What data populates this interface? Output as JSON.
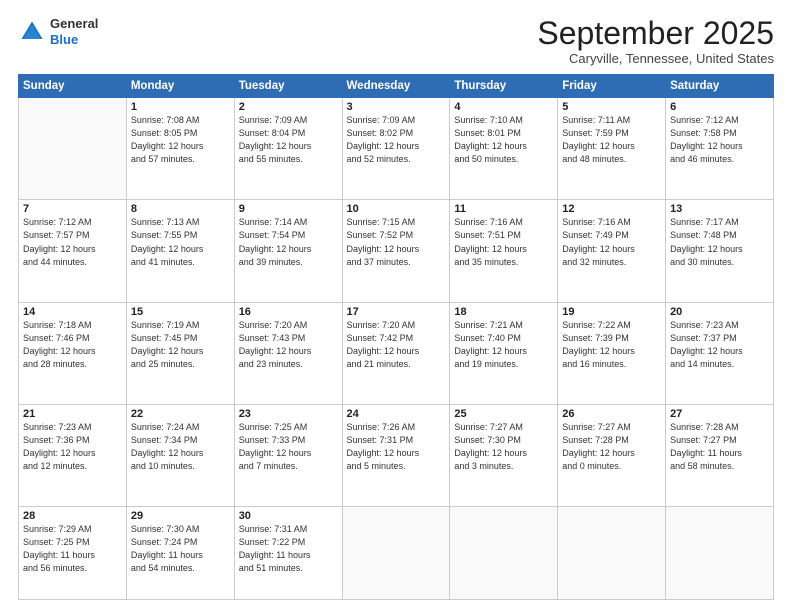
{
  "logo": {
    "general": "General",
    "blue": "Blue"
  },
  "header": {
    "month": "September 2025",
    "location": "Caryville, Tennessee, United States"
  },
  "days_of_week": [
    "Sunday",
    "Monday",
    "Tuesday",
    "Wednesday",
    "Thursday",
    "Friday",
    "Saturday"
  ],
  "weeks": [
    [
      {
        "day": "",
        "info": ""
      },
      {
        "day": "1",
        "info": "Sunrise: 7:08 AM\nSunset: 8:05 PM\nDaylight: 12 hours\nand 57 minutes."
      },
      {
        "day": "2",
        "info": "Sunrise: 7:09 AM\nSunset: 8:04 PM\nDaylight: 12 hours\nand 55 minutes."
      },
      {
        "day": "3",
        "info": "Sunrise: 7:09 AM\nSunset: 8:02 PM\nDaylight: 12 hours\nand 52 minutes."
      },
      {
        "day": "4",
        "info": "Sunrise: 7:10 AM\nSunset: 8:01 PM\nDaylight: 12 hours\nand 50 minutes."
      },
      {
        "day": "5",
        "info": "Sunrise: 7:11 AM\nSunset: 7:59 PM\nDaylight: 12 hours\nand 48 minutes."
      },
      {
        "day": "6",
        "info": "Sunrise: 7:12 AM\nSunset: 7:58 PM\nDaylight: 12 hours\nand 46 minutes."
      }
    ],
    [
      {
        "day": "7",
        "info": "Sunrise: 7:12 AM\nSunset: 7:57 PM\nDaylight: 12 hours\nand 44 minutes."
      },
      {
        "day": "8",
        "info": "Sunrise: 7:13 AM\nSunset: 7:55 PM\nDaylight: 12 hours\nand 41 minutes."
      },
      {
        "day": "9",
        "info": "Sunrise: 7:14 AM\nSunset: 7:54 PM\nDaylight: 12 hours\nand 39 minutes."
      },
      {
        "day": "10",
        "info": "Sunrise: 7:15 AM\nSunset: 7:52 PM\nDaylight: 12 hours\nand 37 minutes."
      },
      {
        "day": "11",
        "info": "Sunrise: 7:16 AM\nSunset: 7:51 PM\nDaylight: 12 hours\nand 35 minutes."
      },
      {
        "day": "12",
        "info": "Sunrise: 7:16 AM\nSunset: 7:49 PM\nDaylight: 12 hours\nand 32 minutes."
      },
      {
        "day": "13",
        "info": "Sunrise: 7:17 AM\nSunset: 7:48 PM\nDaylight: 12 hours\nand 30 minutes."
      }
    ],
    [
      {
        "day": "14",
        "info": "Sunrise: 7:18 AM\nSunset: 7:46 PM\nDaylight: 12 hours\nand 28 minutes."
      },
      {
        "day": "15",
        "info": "Sunrise: 7:19 AM\nSunset: 7:45 PM\nDaylight: 12 hours\nand 25 minutes."
      },
      {
        "day": "16",
        "info": "Sunrise: 7:20 AM\nSunset: 7:43 PM\nDaylight: 12 hours\nand 23 minutes."
      },
      {
        "day": "17",
        "info": "Sunrise: 7:20 AM\nSunset: 7:42 PM\nDaylight: 12 hours\nand 21 minutes."
      },
      {
        "day": "18",
        "info": "Sunrise: 7:21 AM\nSunset: 7:40 PM\nDaylight: 12 hours\nand 19 minutes."
      },
      {
        "day": "19",
        "info": "Sunrise: 7:22 AM\nSunset: 7:39 PM\nDaylight: 12 hours\nand 16 minutes."
      },
      {
        "day": "20",
        "info": "Sunrise: 7:23 AM\nSunset: 7:37 PM\nDaylight: 12 hours\nand 14 minutes."
      }
    ],
    [
      {
        "day": "21",
        "info": "Sunrise: 7:23 AM\nSunset: 7:36 PM\nDaylight: 12 hours\nand 12 minutes."
      },
      {
        "day": "22",
        "info": "Sunrise: 7:24 AM\nSunset: 7:34 PM\nDaylight: 12 hours\nand 10 minutes."
      },
      {
        "day": "23",
        "info": "Sunrise: 7:25 AM\nSunset: 7:33 PM\nDaylight: 12 hours\nand 7 minutes."
      },
      {
        "day": "24",
        "info": "Sunrise: 7:26 AM\nSunset: 7:31 PM\nDaylight: 12 hours\nand 5 minutes."
      },
      {
        "day": "25",
        "info": "Sunrise: 7:27 AM\nSunset: 7:30 PM\nDaylight: 12 hours\nand 3 minutes."
      },
      {
        "day": "26",
        "info": "Sunrise: 7:27 AM\nSunset: 7:28 PM\nDaylight: 12 hours\nand 0 minutes."
      },
      {
        "day": "27",
        "info": "Sunrise: 7:28 AM\nSunset: 7:27 PM\nDaylight: 11 hours\nand 58 minutes."
      }
    ],
    [
      {
        "day": "28",
        "info": "Sunrise: 7:29 AM\nSunset: 7:25 PM\nDaylight: 11 hours\nand 56 minutes."
      },
      {
        "day": "29",
        "info": "Sunrise: 7:30 AM\nSunset: 7:24 PM\nDaylight: 11 hours\nand 54 minutes."
      },
      {
        "day": "30",
        "info": "Sunrise: 7:31 AM\nSunset: 7:22 PM\nDaylight: 11 hours\nand 51 minutes."
      },
      {
        "day": "",
        "info": ""
      },
      {
        "day": "",
        "info": ""
      },
      {
        "day": "",
        "info": ""
      },
      {
        "day": "",
        "info": ""
      }
    ]
  ]
}
